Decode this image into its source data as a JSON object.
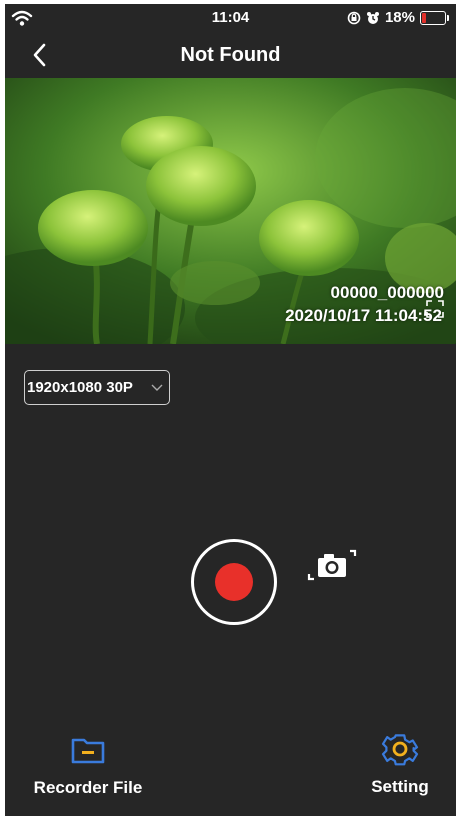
{
  "status_bar": {
    "time": "11:04",
    "battery": "18%",
    "battery_level": 0.18,
    "battery_color": "#e0302a"
  },
  "nav": {
    "title": "Not Found"
  },
  "preview": {
    "osd_id": "00000_000000",
    "osd_datetime": "2020/10/17 11:04:52"
  },
  "resolution": {
    "selected": "1920x1080 30P"
  },
  "record": {
    "accent": "#e8302a"
  },
  "bottom_nav": {
    "recorder_file": {
      "label": "Recorder File",
      "icon": "folder-icon",
      "color": "#3a7bdc"
    },
    "setting": {
      "label": "Setting",
      "icon": "gear-icon",
      "color": "#3a7bdc"
    }
  }
}
